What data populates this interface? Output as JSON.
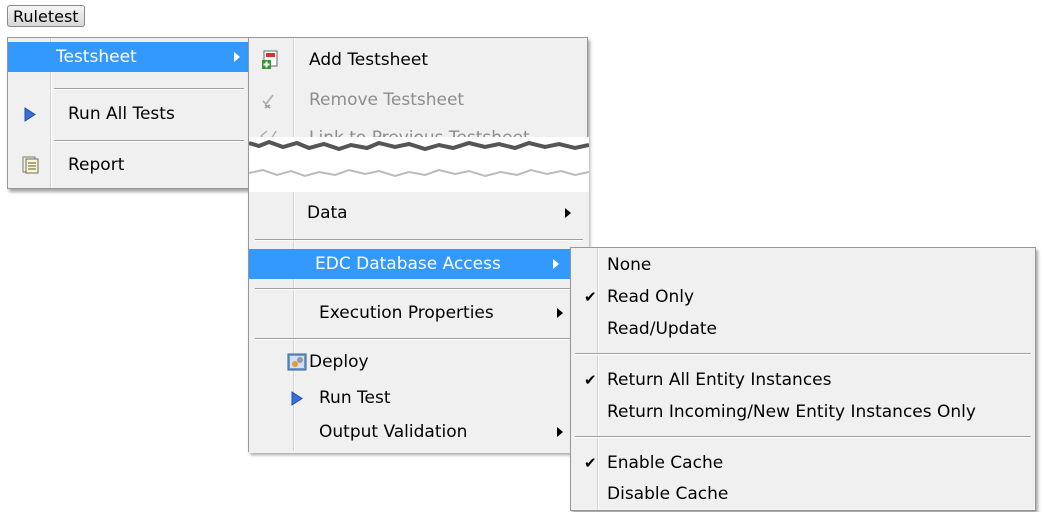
{
  "menubar": {
    "ruletest_label": "Ruletest"
  },
  "ruletest_menu": {
    "items": [
      {
        "label": "Testsheet",
        "icon": "none",
        "has_submenu": true,
        "highlighted": true
      },
      {
        "label": "Run All Tests",
        "icon": "play-icon"
      },
      {
        "label": "Report",
        "icon": "report-icon"
      }
    ]
  },
  "testsheet_submenu": {
    "items": [
      {
        "label": "Add Testsheet",
        "icon": "add-testsheet-icon"
      },
      {
        "label": "Remove Testsheet",
        "icon": "remove-testsheet-icon",
        "disabled": true
      },
      {
        "label": "Link to Previous Testsheet",
        "icon": "link-icon",
        "disabled": true,
        "partially_obscured": true
      },
      {
        "label": "Data",
        "has_submenu": true
      },
      {
        "label": "EDC Database Access",
        "has_submenu": true,
        "highlighted": true
      },
      {
        "label": "Execution Properties",
        "has_submenu": true
      },
      {
        "label": "Deploy",
        "icon": "deploy-icon"
      },
      {
        "label": "Run Test",
        "icon": "play-icon"
      },
      {
        "label": "Output Validation",
        "has_submenu": true
      }
    ]
  },
  "edc_submenu": {
    "items": [
      {
        "label": "None",
        "checked": false
      },
      {
        "label": "Read Only",
        "checked": true
      },
      {
        "label": "Read/Update",
        "checked": false
      },
      {
        "label": "Return All Entity Instances",
        "checked": true
      },
      {
        "label": "Return Incoming/New Entity Instances Only",
        "checked": false
      },
      {
        "label": "Enable Cache",
        "checked": true
      },
      {
        "label": "Disable Cache",
        "checked": false
      }
    ]
  },
  "colors": {
    "highlight": "#3399ff",
    "menu_bg": "#f0f0f0",
    "disabled_text": "#8d8d8d",
    "play_icon": "#3a6fd8"
  },
  "glyphs": {
    "checkmark": "✔"
  }
}
